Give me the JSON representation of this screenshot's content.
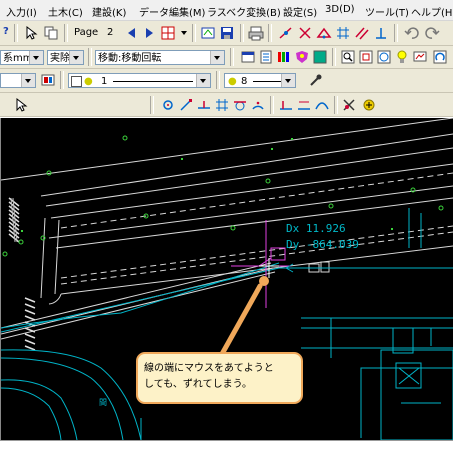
{
  "menu": {
    "items": [
      "入力(I)",
      "土木(C)",
      "建設(K)",
      "データ編集(M)",
      "ラスベク変換(B)",
      "設定(S)",
      "3D(D)",
      "ツール(T)",
      "ヘルプ(H)"
    ]
  },
  "toolbar1": {
    "help_glyph": "?",
    "page_label": "Page",
    "page_number": "2"
  },
  "toolbar2": {
    "unit_value": "系mm",
    "scale_value": "実除",
    "mode_value": "移動:移動回転"
  },
  "toolbar3": {
    "color_value": "1",
    "line_value": "8"
  },
  "cad": {
    "dx_label": "Dx",
    "dx_value": "11.926",
    "dy_label": "Dy",
    "dy_value": "-864.039",
    "label_small": "間"
  },
  "callout": {
    "line1": "線の端にマウスをあてようと",
    "line2": "しても、ずれてしまう。"
  },
  "colors": {
    "canvas_bg": "#000000",
    "cyan": "#00b4c8",
    "magenta": "#e040e0",
    "callout_fill": "#fdf2c8",
    "callout_border": "#f0a85a"
  }
}
